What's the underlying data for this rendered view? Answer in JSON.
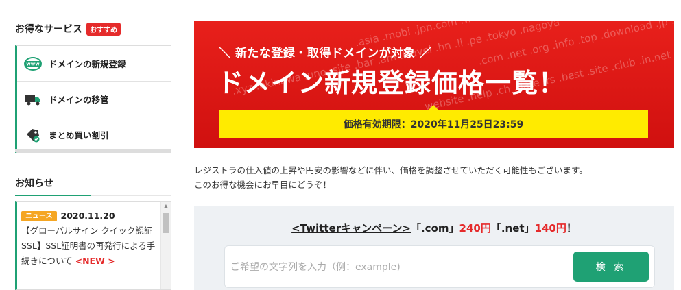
{
  "sidebar": {
    "services_title": "お得なサービス",
    "services_badge": "おすすめ",
    "services": [
      {
        "label": "ドメインの新規登録",
        "icon": "www-globe-icon"
      },
      {
        "label": "ドメインの移管",
        "icon": "transfer-truck-icon"
      },
      {
        "label": "まとめ買い割引",
        "icon": "discount-tag-icon"
      }
    ],
    "news_title": "お知らせ",
    "news": {
      "tag": "ニュース",
      "date": "2020.11.20",
      "text": "【グローバルサイン クイック認証SSL】SSL証明書の再発行による手続きについて",
      "new_label": "<NEW >"
    }
  },
  "banner": {
    "subtitle": "新たな登録・取得ドメインが対象",
    "title": "ドメイン新規登録価格一覧！",
    "period": "価格有効期限：2020年11月25日23:59",
    "tlds": [
      ".asia .mobi .jpn.com .ws .tv .name .link .jp .biz",
      ".xyz .okinawa .uno .site .bar .am .travel .hn .li .pe .tokyo .nagoya",
      ".com .net .org .info .top .download .jp .me .co",
      "website .help .ch .date .rs .best .site .club .in.net .se"
    ],
    "accent_color": "#e52b2b",
    "period_bg": "#ffeb00"
  },
  "intro": {
    "line1": "レジストラの仕入値の上昇や円安の影響などに伴い、価格を調整させていただく可能性もございます。",
    "line2": "このお得な機会にお早目にどうぞ！"
  },
  "search": {
    "campaign_link": "<Twitterキャンペーン>",
    "campaign_com": "「.com」",
    "campaign_com_price": "240円",
    "campaign_net": "「.net」",
    "campaign_net_price": "140円",
    "campaign_end": "！",
    "placeholder": "ご希望の文字列を入力（例：example)",
    "button_label": "検 索",
    "button_color": "#1fa174"
  }
}
